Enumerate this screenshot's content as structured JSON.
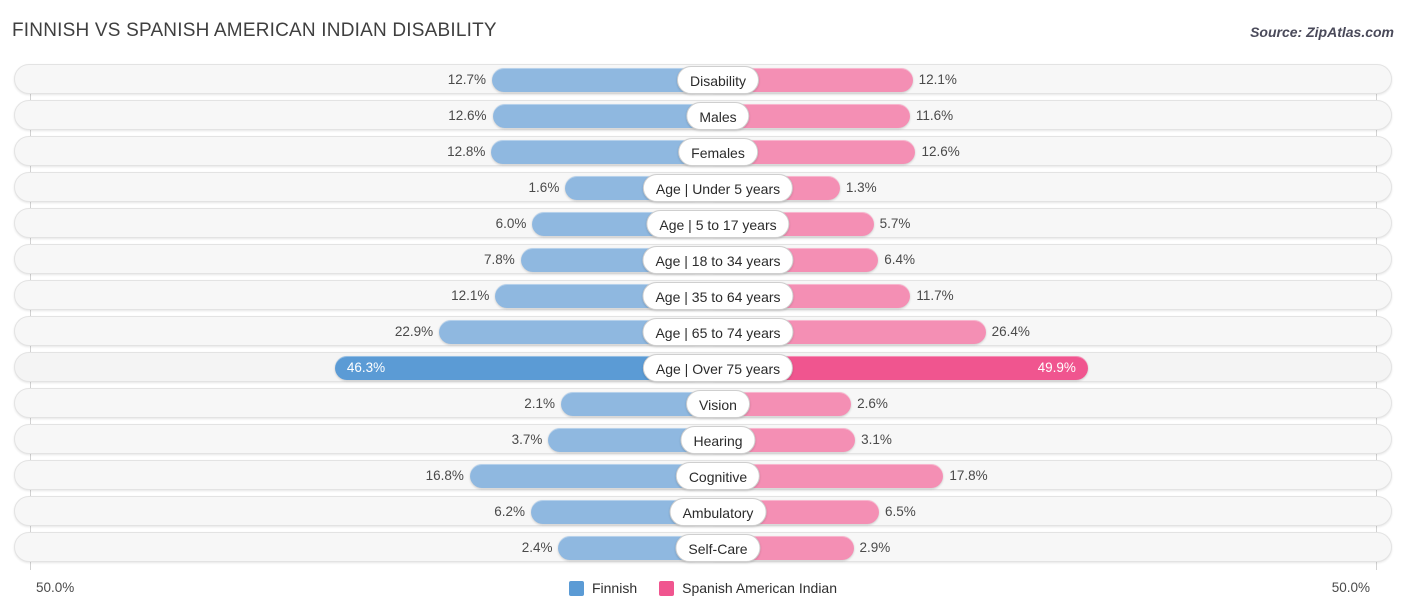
{
  "header": {
    "title": "FINNISH VS SPANISH AMERICAN INDIAN DISABILITY",
    "source": "Source: ZipAtlas.com"
  },
  "axis": {
    "left_max": "50.0%",
    "right_max": "50.0%"
  },
  "legend": {
    "items": [
      {
        "label": "Finnish",
        "color": "#5b9bd5"
      },
      {
        "label": "Spanish American Indian",
        "color": "#f0558f"
      }
    ]
  },
  "colors": {
    "left_bar": "#8fb8e0",
    "right_bar": "#f48fb4",
    "left_bar_highlight": "#5b9bd5",
    "right_bar_highlight": "#f0558f",
    "row_background": "#f7f7f7"
  },
  "chart_data": {
    "type": "bar",
    "title": "FINNISH VS SPANISH AMERICAN INDIAN DISABILITY",
    "xlabel": "",
    "ylabel": "",
    "orientation": "horizontal-diverging",
    "xlim": [
      0,
      50
    ],
    "axis_max_label": "50.0%",
    "grid": true,
    "legend_position": "bottom-center",
    "categories": [
      "Disability",
      "Males",
      "Females",
      "Age | Under 5 years",
      "Age | 5 to 17 years",
      "Age | 18 to 34 years",
      "Age | 35 to 64 years",
      "Age | 65 to 74 years",
      "Age | Over 75 years",
      "Vision",
      "Hearing",
      "Cognitive",
      "Ambulatory",
      "Self-Care"
    ],
    "series": [
      {
        "name": "Finnish",
        "values": [
          12.7,
          12.6,
          12.8,
          1.6,
          6.0,
          7.8,
          12.1,
          22.9,
          46.3,
          2.1,
          3.7,
          16.8,
          6.2,
          2.4
        ],
        "labels": [
          "12.7%",
          "12.6%",
          "12.8%",
          "1.6%",
          "6.0%",
          "7.8%",
          "12.1%",
          "22.9%",
          "46.3%",
          "2.1%",
          "3.7%",
          "16.8%",
          "6.2%",
          "2.4%"
        ]
      },
      {
        "name": "Spanish American Indian",
        "values": [
          12.1,
          11.6,
          12.6,
          1.3,
          5.7,
          6.4,
          11.7,
          26.4,
          49.9,
          2.6,
          3.1,
          17.8,
          6.5,
          2.9
        ],
        "labels": [
          "12.1%",
          "11.6%",
          "12.6%",
          "1.3%",
          "5.7%",
          "6.4%",
          "11.7%",
          "26.4%",
          "49.9%",
          "2.6%",
          "3.1%",
          "17.8%",
          "6.5%",
          "2.9%"
        ]
      }
    ],
    "highlight_row_index": 8
  },
  "rows": [
    {
      "label": "Disability",
      "left": "12.7%",
      "right": "12.1%",
      "lv": 12.7,
      "rv": 12.1,
      "hl": false
    },
    {
      "label": "Males",
      "left": "12.6%",
      "right": "11.6%",
      "lv": 12.6,
      "rv": 11.6,
      "hl": false
    },
    {
      "label": "Females",
      "left": "12.8%",
      "right": "12.6%",
      "lv": 12.8,
      "rv": 12.6,
      "hl": false
    },
    {
      "label": "Age | Under 5 years",
      "left": "1.6%",
      "right": "1.3%",
      "lv": 1.6,
      "rv": 1.3,
      "hl": false
    },
    {
      "label": "Age | 5 to 17 years",
      "left": "6.0%",
      "right": "5.7%",
      "lv": 6.0,
      "rv": 5.7,
      "hl": false
    },
    {
      "label": "Age | 18 to 34 years",
      "left": "7.8%",
      "right": "6.4%",
      "lv": 7.8,
      "rv": 6.4,
      "hl": false
    },
    {
      "label": "Age | 35 to 64 years",
      "left": "12.1%",
      "right": "11.7%",
      "lv": 12.1,
      "rv": 11.7,
      "hl": false
    },
    {
      "label": "Age | 65 to 74 years",
      "left": "22.9%",
      "right": "26.4%",
      "lv": 22.9,
      "rv": 26.4,
      "hl": false
    },
    {
      "label": "Age | Over 75 years",
      "left": "46.3%",
      "right": "49.9%",
      "lv": 46.3,
      "rv": 49.9,
      "hl": true
    },
    {
      "label": "Vision",
      "left": "2.1%",
      "right": "2.6%",
      "lv": 2.1,
      "rv": 2.6,
      "hl": false
    },
    {
      "label": "Hearing",
      "left": "3.7%",
      "right": "3.1%",
      "lv": 3.7,
      "rv": 3.1,
      "hl": false
    },
    {
      "label": "Cognitive",
      "left": "16.8%",
      "right": "17.8%",
      "lv": 16.8,
      "rv": 17.8,
      "hl": false
    },
    {
      "label": "Ambulatory",
      "left": "6.2%",
      "right": "6.5%",
      "lv": 6.2,
      "rv": 6.5,
      "hl": false
    },
    {
      "label": "Self-Care",
      "left": "2.4%",
      "right": "2.9%",
      "lv": 2.4,
      "rv": 2.9,
      "hl": false
    }
  ]
}
